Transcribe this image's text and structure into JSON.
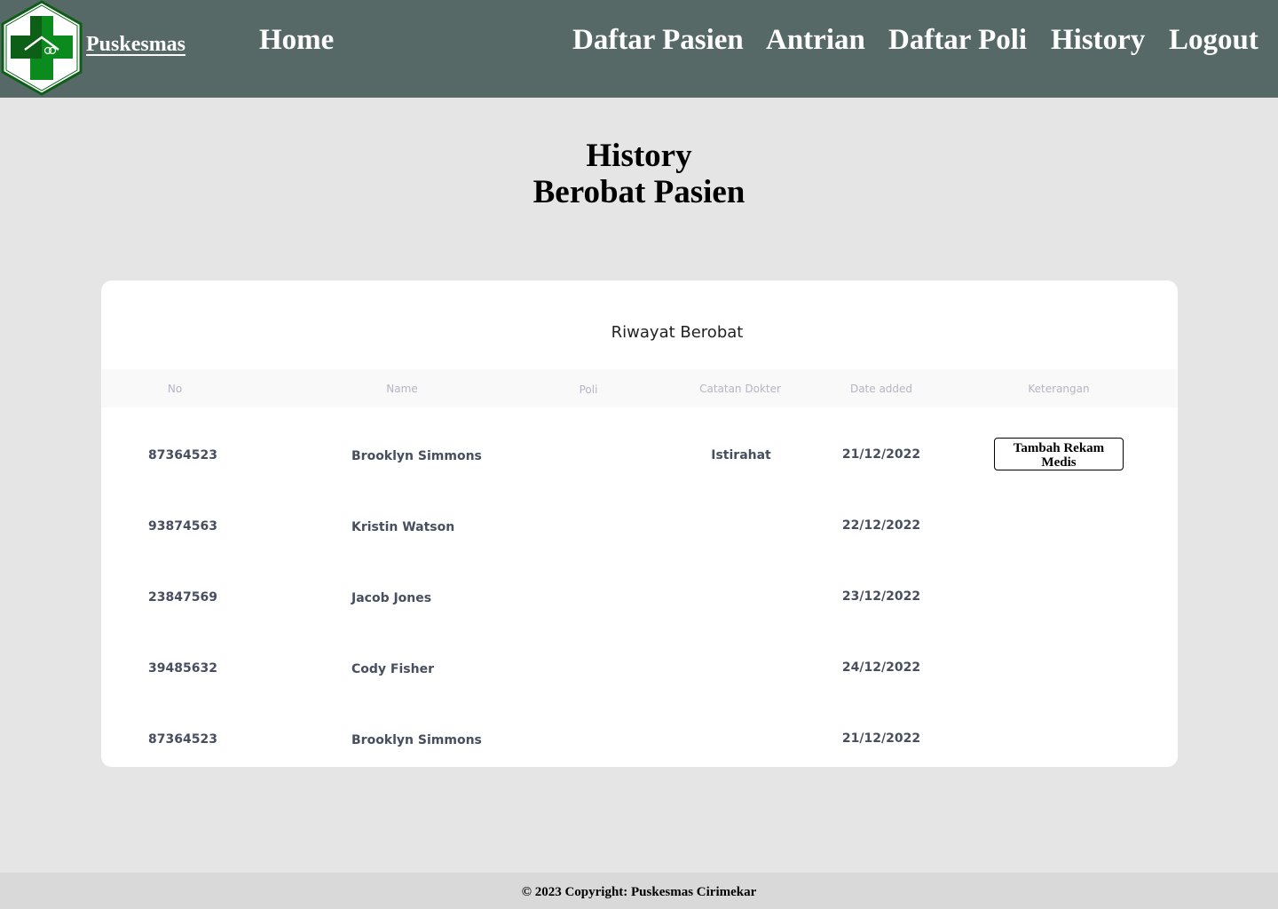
{
  "header": {
    "brand": "Puskesmas",
    "nav": {
      "home": "Home",
      "daftar_pasien": "Daftar Pasien",
      "antrian": "Antrian",
      "daftar_poli": "Daftar Poli",
      "history": "History",
      "logout": "Logout"
    },
    "logo_icon": "puskesmas-logo-icon",
    "colors": {
      "bar": "#566967",
      "logo_green": "#0b8a1e",
      "logo_dark_green": "#0d5f17"
    }
  },
  "page": {
    "title_line1": "History",
    "title_line2": "Berobat Pasien"
  },
  "table": {
    "title": "Riwayat Berobat",
    "columns": {
      "no": "No",
      "name": "Name",
      "poli": "Poli",
      "catatan": "Catatan Dokter",
      "date": "Date added",
      "keterangan": "Keterangan"
    },
    "rows": [
      {
        "no": "87364523",
        "name": "Brooklyn Simmons",
        "catatan": "Istirahat",
        "date": "21/12/2022",
        "action": "Tambah Rekam Medis"
      },
      {
        "no": "93874563",
        "name": "Kristin Watson",
        "date": "22/12/2022"
      },
      {
        "no": "23847569",
        "name": "Jacob Jones",
        "date": "23/12/2022"
      },
      {
        "no": "39485632",
        "name": "Cody Fisher",
        "date": "24/12/2022"
      },
      {
        "no": "87364523",
        "name": "Brooklyn Simmons",
        "date": "21/12/2022"
      }
    ]
  },
  "footer": {
    "text": "© 2023 Copyright: Puskesmas Cirimekar"
  }
}
